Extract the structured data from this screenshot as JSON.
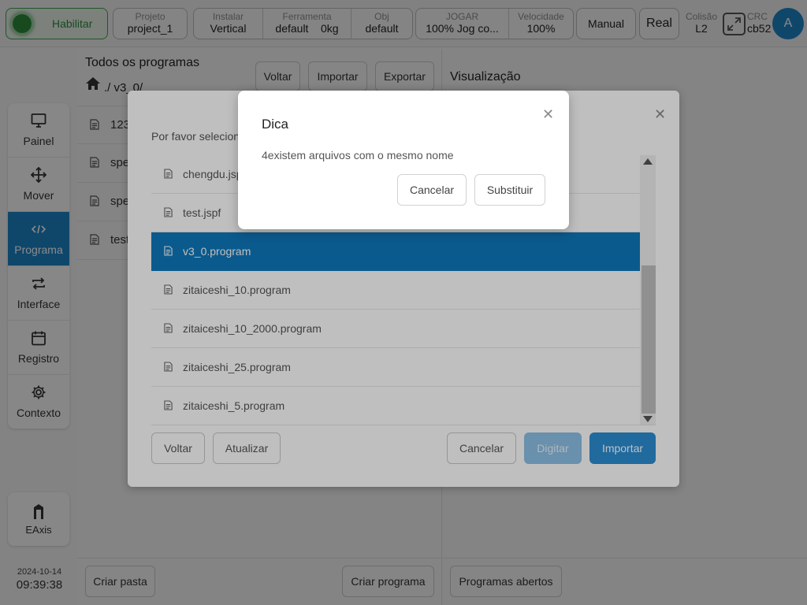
{
  "topbar": {
    "enable_label": "Habilitar",
    "project": {
      "label": "Projeto",
      "value": "project_1"
    },
    "install": {
      "label": "Instalar",
      "value": "Vertical"
    },
    "tool": {
      "label": "Ferramenta",
      "value": "default",
      "weight": "0kg"
    },
    "obj": {
      "label": "Obj",
      "value": "default"
    },
    "jog": {
      "label": "JOGAR",
      "value": "100%  Jog co..."
    },
    "speed": {
      "label": "Velocidade",
      "value": "100%"
    },
    "manual_label": "Manual",
    "real_label": "Real",
    "collision": {
      "label": "Colisão",
      "value": "L2"
    },
    "crc": {
      "label": "CRC",
      "value": "cb52"
    },
    "avatar": "A",
    "accent_color": "#1c84c6",
    "enable_color": "#2e8a3c"
  },
  "sidebar": {
    "items": [
      {
        "label": "Painel",
        "icon": "monitor-icon"
      },
      {
        "label": "Mover",
        "icon": "move-arrows-icon"
      },
      {
        "label": "Programa",
        "icon": "code-icon",
        "active": true
      },
      {
        "label": "Interface",
        "icon": "swap-arrows-icon"
      },
      {
        "label": "Registro",
        "icon": "calendar-icon"
      },
      {
        "label": "Contexto",
        "icon": "gear-icon"
      }
    ],
    "eaxis_label": "EAxis",
    "date": "2024-10-14",
    "time": "09:39:38"
  },
  "programs": {
    "title": "Todos os programas",
    "path": "./ v3_0/",
    "buttons": {
      "back": "Voltar",
      "import": "Importar",
      "export": "Exportar"
    },
    "files": [
      "123",
      "spe",
      "spe",
      "test"
    ],
    "new_folder": "Criar pasta",
    "new_program": "Criar programa"
  },
  "preview": {
    "title": "Visualização",
    "open_programs": "Programas abertos"
  },
  "import_dialog": {
    "prompt": "Por favor selecion",
    "files": [
      "chengdu.jspf",
      "test.jspf",
      "v3_0.program",
      "zitaiceshi_10.program",
      "zitaiceshi_10_2000.program",
      "zitaiceshi_25.program",
      "zitaiceshi_5.program"
    ],
    "selected_index": 2,
    "buttons": {
      "back": "Voltar",
      "refresh": "Atualizar",
      "cancel": "Cancelar",
      "type": "Digitar",
      "import": "Importar"
    }
  },
  "tip_dialog": {
    "title": "Dica",
    "message": "4existem arquivos com o mesmo nome",
    "cancel": "Cancelar",
    "replace": "Substituir"
  }
}
